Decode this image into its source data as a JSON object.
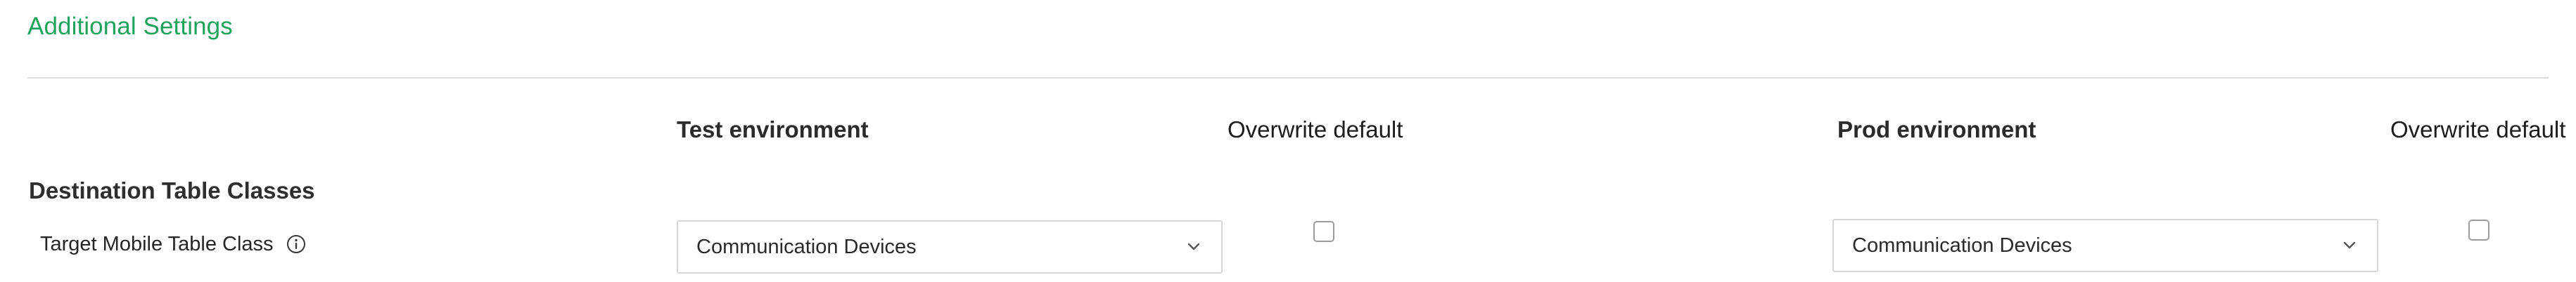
{
  "section": {
    "title": "Additional Settings"
  },
  "columns": {
    "test_env": "Test environment",
    "test_overwrite": "Overwrite default",
    "prod_env": "Prod environment",
    "prod_overwrite": "Overwrite default"
  },
  "group": {
    "title": "Destination Table Classes",
    "rows": [
      {
        "label": "Target Mobile Table Class",
        "info_icon": "info-circle-icon",
        "test_value": "Communication Devices",
        "test_overwrite_checked": false,
        "prod_value": "Communication Devices",
        "prod_overwrite_checked": false
      }
    ]
  },
  "colors": {
    "accent": "#1fa35c",
    "divider": "#dcdcdc",
    "input_border": "#d6d6d6"
  }
}
